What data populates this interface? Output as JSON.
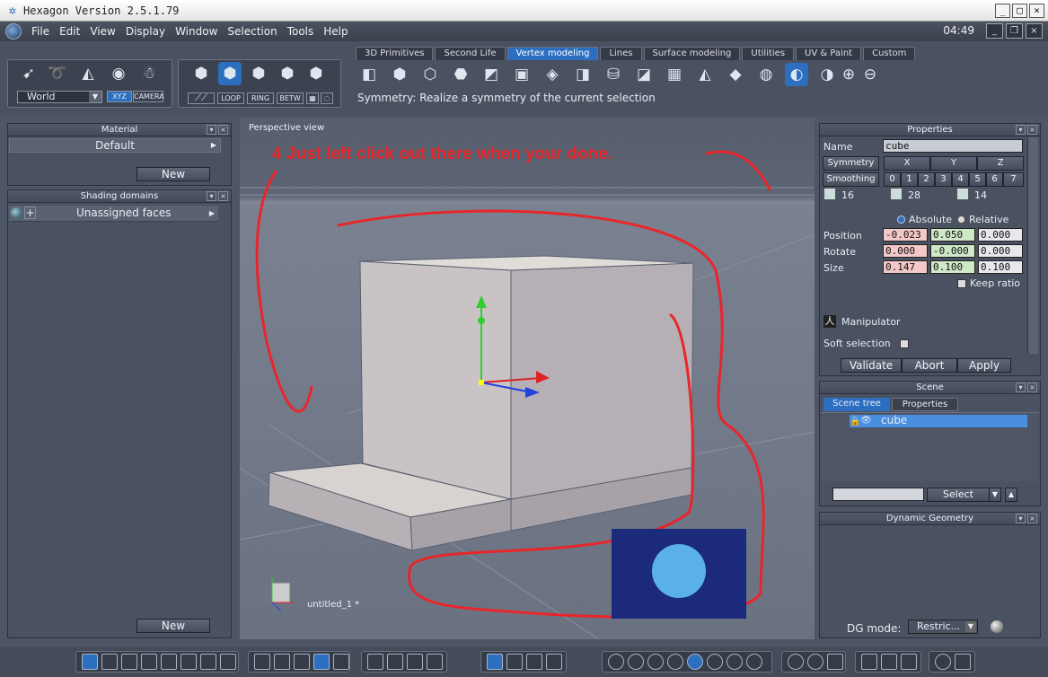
{
  "window": {
    "title": "Hexagon Version 2.5.1.79",
    "clock": "04:49"
  },
  "menu": [
    "File",
    "Edit",
    "View",
    "Display",
    "Window",
    "Selection",
    "Tools",
    "Help"
  ],
  "tabs": [
    "3D Primitives",
    "Second Life",
    "Vertex modeling",
    "Lines",
    "Surface modeling",
    "Utilities",
    "UV & Paint",
    "Custom"
  ],
  "active_tab": "Vertex modeling",
  "toolbar": {
    "world_select": "World",
    "xyz": "XYZ",
    "camera": "CAMERA",
    "loop": "LOOP",
    "ring": "RING",
    "betw": "BETW",
    "status": "Symmetry: Realize a symmetry of the current selection"
  },
  "material_panel": {
    "title": "Material",
    "item": "Default",
    "new_button": "New"
  },
  "shading_panel": {
    "title": "Shading domains",
    "item": "Unassigned faces",
    "new_button": "New"
  },
  "viewport": {
    "label": "Perspective view",
    "file": "untitled_1 *",
    "annotation": "4 Just left click out there when your done."
  },
  "properties": {
    "title": "Properties",
    "name_label": "Name",
    "name_value": "cube",
    "symmetry_label": "Symmetry",
    "axes": [
      "X",
      "Y",
      "Z"
    ],
    "smoothing_label": "Smoothing",
    "smoothing_levels": [
      "0",
      "1",
      "2",
      "3",
      "4",
      "5",
      "6",
      "7"
    ],
    "counts": [
      "16",
      "28",
      "14"
    ],
    "absolute": "Absolute",
    "relative": "Relative",
    "position_label": "Position",
    "position": [
      "-0.023",
      "0.050",
      "0.000"
    ],
    "rotate_label": "Rotate",
    "rotate": [
      "0.000",
      "-0.000",
      "0.000"
    ],
    "size_label": "Size",
    "size": [
      "0.147",
      "0.100",
      "0.100"
    ],
    "keep_ratio": "Keep ratio",
    "manipulator": "Manipulator",
    "soft_selection": "Soft selection",
    "validate": "Validate",
    "abort": "Abort",
    "apply": "Apply"
  },
  "scene": {
    "title": "Scene",
    "tabs": [
      "Scene tree",
      "Properties"
    ],
    "item": "cube",
    "select_button": "Select"
  },
  "dynamic_geometry": {
    "title": "Dynamic Geometry",
    "mode_label": "DG mode:",
    "mode_value": "Restric..."
  },
  "colors": {
    "accent": "#2c6fc0",
    "annotation": "#e8262a",
    "background": "#4d5566"
  }
}
